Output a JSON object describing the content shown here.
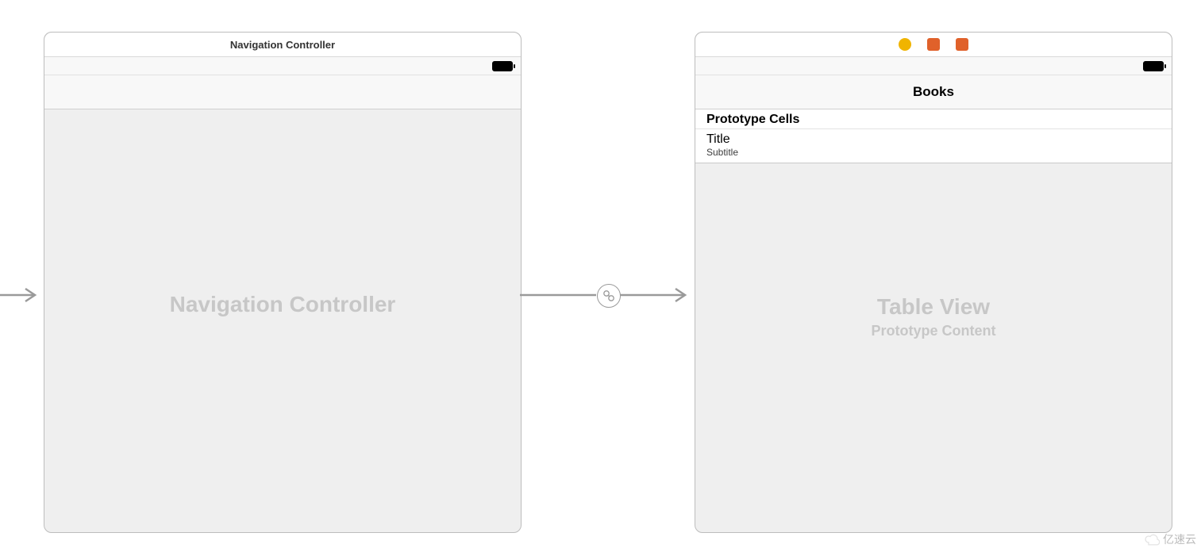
{
  "left_scene": {
    "header_title": "Navigation Controller",
    "placeholder": "Navigation Controller"
  },
  "segue": {
    "kind": "relationship"
  },
  "right_scene": {
    "icons": [
      "view-controller-icon",
      "first-responder-icon",
      "exit-icon"
    ],
    "icon_colors": [
      "#f0b400",
      "#e0612a",
      "#e0612a"
    ],
    "nav_title": "Books",
    "section_header": "Prototype Cells",
    "cell_title": "Title",
    "cell_subtitle": "Subtitle",
    "table_placeholder_title": "Table View",
    "table_placeholder_sub": "Prototype Content"
  },
  "watermark": "亿速云"
}
